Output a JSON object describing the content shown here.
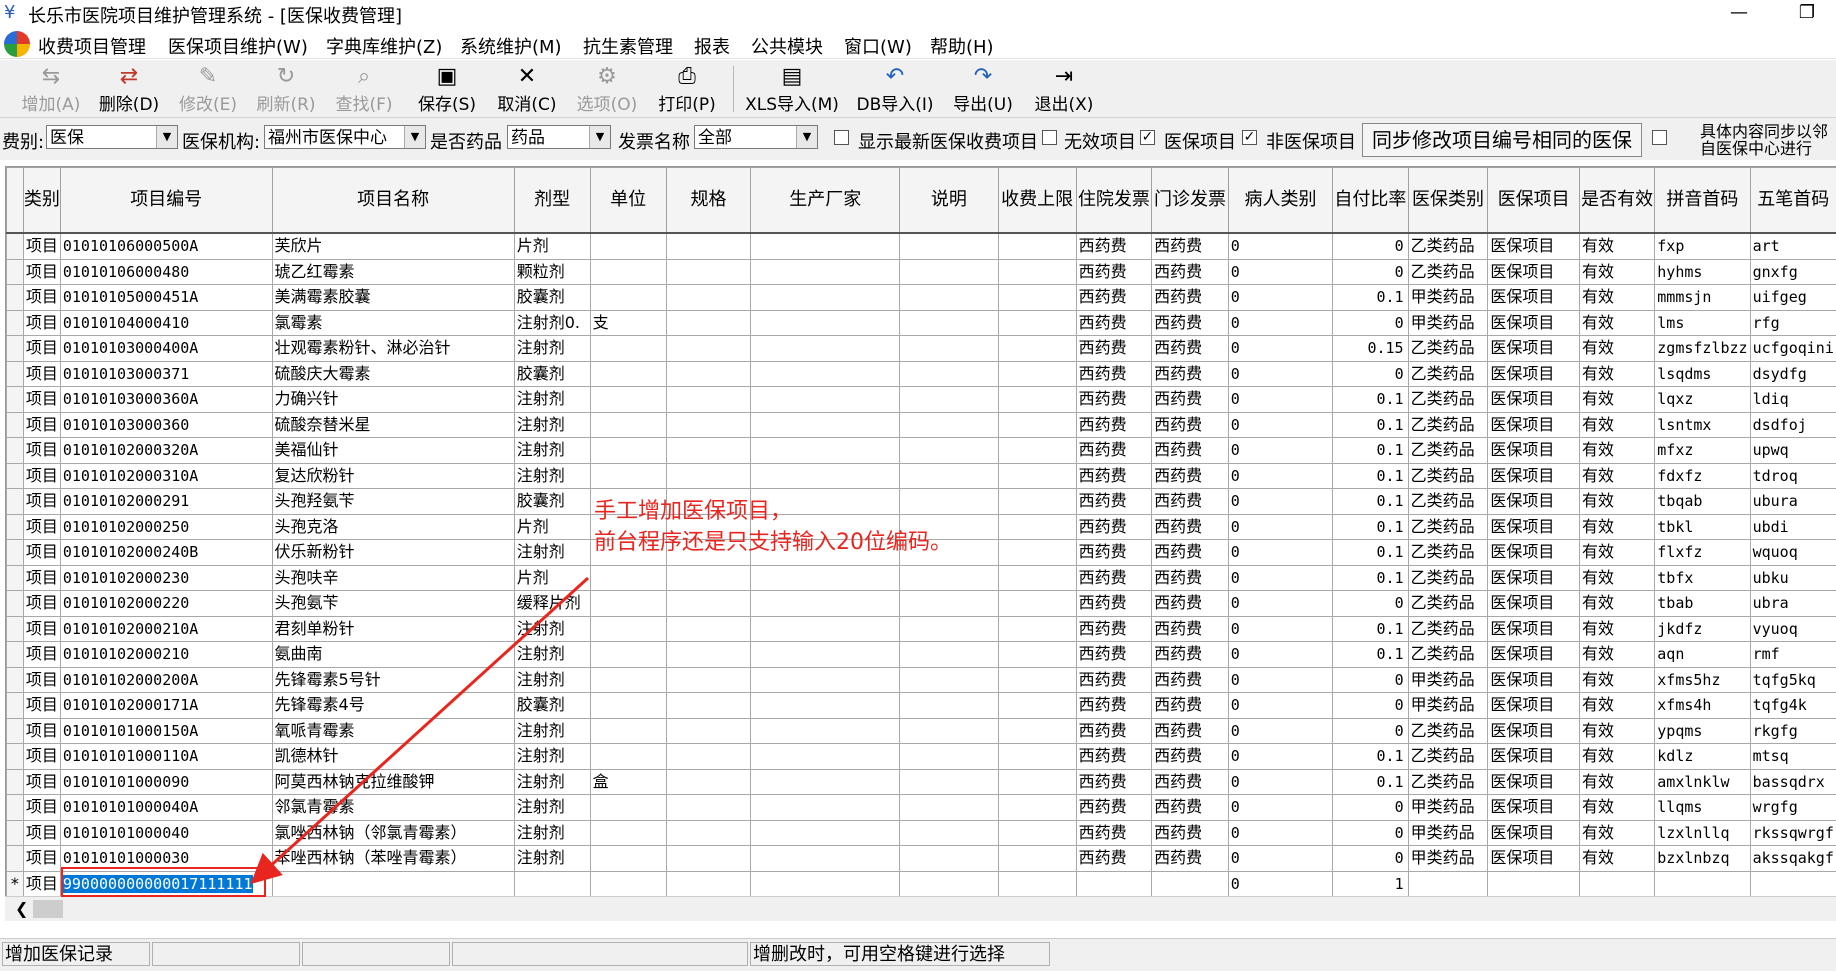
{
  "window": {
    "title": "长乐市医院项目维护管理系统 - [医保收费管理]",
    "minimize": "—",
    "restore": "❐"
  },
  "menus": [
    "收费项目管理",
    "医保项目维护(W)",
    "字典库维护(Z)",
    "系统维护(M)",
    "抗生素管理",
    "报表",
    "公共模块",
    "窗口(W)",
    "帮助(H)"
  ],
  "toolbar": [
    {
      "label": "增加(A)",
      "icon": "add-icon",
      "glyph": "⇆",
      "enabled": false
    },
    {
      "label": "删除(D)",
      "icon": "delete-icon",
      "glyph": "⇄",
      "enabled": true
    },
    {
      "label": "修改(E)",
      "icon": "edit-icon",
      "glyph": "✎",
      "enabled": false
    },
    {
      "label": "刷新(R)",
      "icon": "refresh-icon",
      "glyph": "↻",
      "enabled": false
    },
    {
      "label": "查找(F)",
      "icon": "find-icon",
      "glyph": "⌕",
      "enabled": false
    },
    {
      "label": "保存(S)",
      "icon": "save-icon",
      "glyph": "▣",
      "enabled": true
    },
    {
      "label": "取消(C)",
      "icon": "cancel-icon",
      "glyph": "✕",
      "enabled": true
    },
    {
      "label": "选项(O)",
      "icon": "options-icon",
      "glyph": "⚙",
      "enabled": false
    },
    {
      "label": "打印(P)",
      "icon": "print-icon",
      "glyph": "⎙",
      "enabled": true
    },
    {
      "label": "XLS导入(M)",
      "icon": "xls-import-icon",
      "glyph": "▤",
      "enabled": true
    },
    {
      "label": "DB导入(I)",
      "icon": "db-import-icon",
      "glyph": "↶",
      "enabled": true
    },
    {
      "label": "导出(U)",
      "icon": "export-icon",
      "glyph": "↷",
      "enabled": true
    },
    {
      "label": "退出(X)",
      "icon": "exit-icon",
      "glyph": "⇥",
      "enabled": true
    }
  ],
  "filters": {
    "fee_type_label": "费别:",
    "fee_type_value": "医保",
    "institution_label": "医保机构:",
    "institution_value": "福州市医保中心",
    "is_drug_label": "是否药品",
    "is_drug_value": "药品",
    "invoice_label": "发票名称",
    "invoice_value": "全部",
    "show_latest": {
      "label": "显示最新医保收费项目",
      "checked": false
    },
    "invalid_items": {
      "label": "无效项目",
      "checked": false
    },
    "insurance_items": {
      "label": "医保项目",
      "checked": true
    },
    "non_insurance_items": {
      "label": "非医保项目",
      "checked": true
    },
    "sync_button": "同步修改项目编号相同的医保",
    "sync_checkbox_checked": false,
    "sync_note_line1": "具体内容同步以邻",
    "sync_note_line2": "自医保中心进行"
  },
  "table": {
    "columns": [
      "类别",
      "项目编号",
      "项目名称",
      "剂型",
      "单位",
      "规格",
      "生产厂家",
      "说明",
      "收费上限",
      "住院发票",
      "门诊发票",
      "病人类别",
      "自付比率",
      "医保类别",
      "医保项目",
      "是否有效",
      "拼音首码",
      "五笔首码"
    ],
    "rows": [
      [
        "项目",
        "01010106000500A",
        "芙欣片",
        "片剂",
        "",
        "",
        "",
        "",
        "",
        "西药费",
        "西药费",
        "0",
        "0",
        "乙类药品",
        "医保项目",
        "有效",
        "fxp",
        "art"
      ],
      [
        "项目",
        "01010106000480",
        "琥乙红霉素",
        "颗粒剂",
        "",
        "",
        "",
        "",
        "",
        "西药费",
        "西药费",
        "0",
        "0",
        "乙类药品",
        "医保项目",
        "有效",
        "hyhms",
        "gnxfg"
      ],
      [
        "项目",
        "01010105000451A",
        "美满霉素胶囊",
        "胶囊剂",
        "",
        "",
        "",
        "",
        "",
        "西药费",
        "西药费",
        "0",
        "0.1",
        "甲类药品",
        "医保项目",
        "有效",
        "mmmsjn",
        "uifgeg"
      ],
      [
        "项目",
        "01010104000410",
        "氯霉素",
        "注射剂0.",
        "支",
        "",
        "",
        "",
        "",
        "西药费",
        "西药费",
        "0",
        "0",
        "甲类药品",
        "医保项目",
        "有效",
        "lms",
        "rfg"
      ],
      [
        "项目",
        "01010103000400A",
        "壮观霉素粉针、淋必治针",
        "注射剂",
        "",
        "",
        "",
        "",
        "",
        "西药费",
        "西药费",
        "0",
        "0.15",
        "乙类药品",
        "医保项目",
        "有效",
        "zgmsfzlbzz",
        "ucfgoqini"
      ],
      [
        "项目",
        "01010103000371",
        "硫酸庆大霉素",
        "胶囊剂",
        "",
        "",
        "",
        "",
        "",
        "西药费",
        "西药费",
        "0",
        "0",
        "乙类药品",
        "医保项目",
        "有效",
        "lsqdms",
        "dsydfg"
      ],
      [
        "项目",
        "01010103000360A",
        "力确兴针",
        "注射剂",
        "",
        "",
        "",
        "",
        "",
        "西药费",
        "西药费",
        "0",
        "0.1",
        "乙类药品",
        "医保项目",
        "有效",
        "lqxz",
        "ldiq"
      ],
      [
        "项目",
        "01010103000360",
        "硫酸奈替米星",
        "注射剂",
        "",
        "",
        "",
        "",
        "",
        "西药费",
        "西药费",
        "0",
        "0.1",
        "乙类药品",
        "医保项目",
        "有效",
        "lsntmx",
        "dsdfoj"
      ],
      [
        "项目",
        "01010102000320A",
        "美福仙针",
        "注射剂",
        "",
        "",
        "",
        "",
        "",
        "西药费",
        "西药费",
        "0",
        "0.1",
        "乙类药品",
        "医保项目",
        "有效",
        "mfxz",
        "upwq"
      ],
      [
        "项目",
        "01010102000310A",
        "复达欣粉针",
        "注射剂",
        "",
        "",
        "",
        "",
        "",
        "西药费",
        "西药费",
        "0",
        "0.1",
        "乙类药品",
        "医保项目",
        "有效",
        "fdxfz",
        "tdroq"
      ],
      [
        "项目",
        "01010102000291",
        "头孢羟氨苄",
        "胶囊剂",
        "",
        "",
        "",
        "",
        "",
        "西药费",
        "西药费",
        "0",
        "0.1",
        "乙类药品",
        "医保项目",
        "有效",
        "tbqab",
        "ubura"
      ],
      [
        "项目",
        "01010102000250",
        "头孢克洛",
        "片剂",
        "",
        "",
        "",
        "",
        "",
        "西药费",
        "西药费",
        "0",
        "0.1",
        "乙类药品",
        "医保项目",
        "有效",
        "tbkl",
        "ubdi"
      ],
      [
        "项目",
        "01010102000240B",
        "伏乐新粉针",
        "注射剂",
        "",
        "",
        "",
        "",
        "",
        "西药费",
        "西药费",
        "0",
        "0.1",
        "乙类药品",
        "医保项目",
        "有效",
        "flxfz",
        "wquoq"
      ],
      [
        "项目",
        "01010102000230",
        "头孢呋辛",
        "片剂",
        "",
        "",
        "",
        "",
        "",
        "西药费",
        "西药费",
        "0",
        "0.1",
        "乙类药品",
        "医保项目",
        "有效",
        "tbfx",
        "ubku"
      ],
      [
        "项目",
        "01010102000220",
        "头孢氨苄",
        "缓释片剂",
        "",
        "",
        "",
        "",
        "",
        "西药费",
        "西药费",
        "0",
        "0",
        "乙类药品",
        "医保项目",
        "有效",
        "tbab",
        "ubra"
      ],
      [
        "项目",
        "01010102000210A",
        "君刻单粉针",
        "注射剂",
        "",
        "",
        "",
        "",
        "",
        "西药费",
        "西药费",
        "0",
        "0.1",
        "乙类药品",
        "医保项目",
        "有效",
        "jkdfz",
        "vyuoq"
      ],
      [
        "项目",
        "01010102000210",
        "氨曲南",
        "注射剂",
        "",
        "",
        "",
        "",
        "",
        "西药费",
        "西药费",
        "0",
        "0.1",
        "乙类药品",
        "医保项目",
        "有效",
        "aqn",
        "rmf"
      ],
      [
        "项目",
        "01010102000200A",
        "先锋霉素5号针",
        "注射剂",
        "",
        "",
        "",
        "",
        "",
        "西药费",
        "西药费",
        "0",
        "0",
        "甲类药品",
        "医保项目",
        "有效",
        "xfms5hz",
        "tqfg5kq"
      ],
      [
        "项目",
        "01010102000171A",
        "先锋霉素4号",
        "胶囊剂",
        "",
        "",
        "",
        "",
        "",
        "西药费",
        "西药费",
        "0",
        "0",
        "甲类药品",
        "医保项目",
        "有效",
        "xfms4h",
        "tqfg4k"
      ],
      [
        "项目",
        "01010101000150A",
        "氧哌青霉素",
        "注射剂",
        "",
        "",
        "",
        "",
        "",
        "西药费",
        "西药费",
        "0",
        "0",
        "乙类药品",
        "医保项目",
        "有效",
        "ypqms",
        "rkgfg"
      ],
      [
        "项目",
        "01010101000110A",
        "凯德林针",
        "注射剂",
        "",
        "",
        "",
        "",
        "",
        "西药费",
        "西药费",
        "0",
        "0.1",
        "乙类药品",
        "医保项目",
        "有效",
        "kdlz",
        "mtsq"
      ],
      [
        "项目",
        "01010101000090",
        "阿莫西林钠克拉维酸钾",
        "注射剂",
        "盒",
        "",
        "",
        "",
        "",
        "西药费",
        "西药费",
        "0",
        "0.1",
        "乙类药品",
        "医保项目",
        "有效",
        "amxlnklw",
        "bassqdrx"
      ],
      [
        "项目",
        "01010101000040A",
        "邻氯青霉素",
        "注射剂",
        "",
        "",
        "",
        "",
        "",
        "西药费",
        "西药费",
        "0",
        "0",
        "甲类药品",
        "医保项目",
        "有效",
        "llqms",
        "wrgfg"
      ],
      [
        "项目",
        "01010101000040",
        "氯唑西林钠（邻氯青霉素）",
        "注射剂",
        "",
        "",
        "",
        "",
        "",
        "西药费",
        "西药费",
        "0",
        "0",
        "甲类药品",
        "医保项目",
        "有效",
        "lzxlnllq",
        "rkssqwrgf"
      ],
      [
        "项目",
        "01010101000030",
        "苯唑西林钠（苯唑青霉素）",
        "注射剂",
        "",
        "",
        "",
        "",
        "",
        "西药费",
        "西药费",
        "0",
        "0",
        "甲类药品",
        "医保项目",
        "有效",
        "bzxlnbzq",
        "akssqakgf"
      ]
    ],
    "new_row": {
      "indicator": "*",
      "category": "项目",
      "code": "990000000000017111111",
      "patient_type": "0",
      "self_pay_ratio": "1"
    }
  },
  "annotation": {
    "line1": "手工增加医保项目，",
    "line2": "前台程序还是只支持输入20位编码。",
    "color": "#e8261f"
  },
  "statusbar": {
    "panel1": "增加医保记录",
    "panel2": "",
    "panel3": "",
    "panel4": "增删改时，可用空格键进行选择",
    "panel5": ""
  }
}
